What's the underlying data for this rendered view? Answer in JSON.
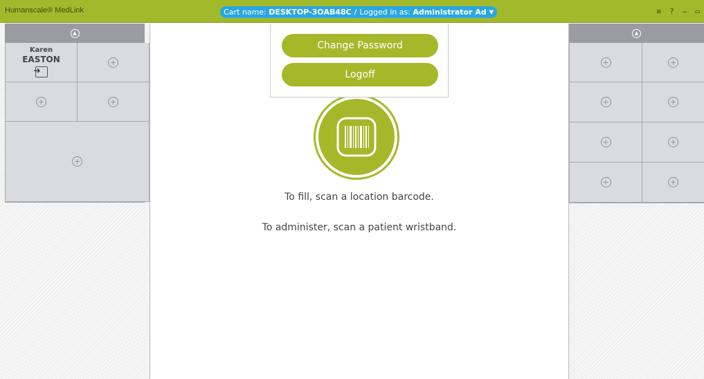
{
  "app": {
    "title": "Humanscale® MedLink"
  },
  "header": {
    "cart_label": "Cart name:",
    "cart_name": "DESKTOP-3OAB48C",
    "separator": "/",
    "logged_in_label": "Logged in as:",
    "user": "Administrator Ad",
    "window_controls": [
      "≡",
      "?",
      "–",
      "▭"
    ]
  },
  "dropdown": {
    "change_password": "Change Password",
    "logoff": "Logoff"
  },
  "left_panel": {
    "patient": {
      "first_name": "Karen",
      "last_name": "EASTON"
    }
  },
  "center": {
    "fill_message": "To fill, scan a location barcode.",
    "administer_message": "To administer, scan a patient wristband."
  },
  "colors": {
    "accent": "#a5b829",
    "titlebar": "#a3b92c",
    "pill": "#2aa7e0"
  }
}
